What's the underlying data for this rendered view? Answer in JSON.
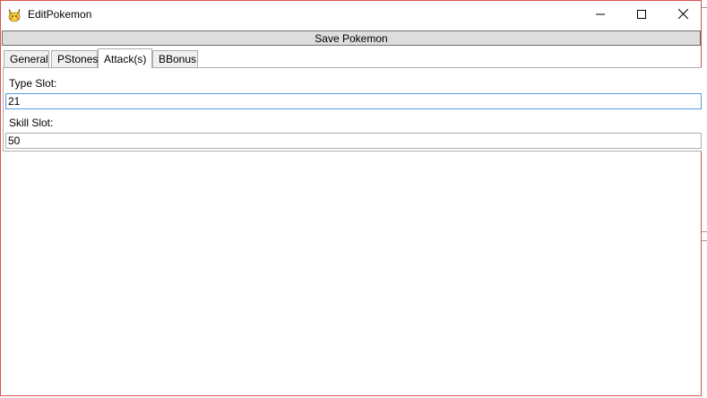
{
  "window": {
    "title": "EditPokemon",
    "icon": "pikachu-icon"
  },
  "titlebar_buttons": {
    "minimize": "minimize-icon",
    "maximize": "maximize-icon",
    "close": "close-icon"
  },
  "toolbar": {
    "save_label": "Save Pokemon"
  },
  "tabs": [
    {
      "label": "General",
      "selected": false
    },
    {
      "label": "PStones",
      "selected": false
    },
    {
      "label": "Attack(s)",
      "selected": true
    },
    {
      "label": "BBonus",
      "selected": false
    }
  ],
  "attacks_panel": {
    "type_slot_label": "Type Slot:",
    "type_slot_value": "21",
    "skill_slot_label": "Skill Slot:",
    "skill_slot_value": "50"
  },
  "colors": {
    "window_border": "#d9534f",
    "focus_border": "#569de5",
    "button_bg": "#dddddd"
  }
}
